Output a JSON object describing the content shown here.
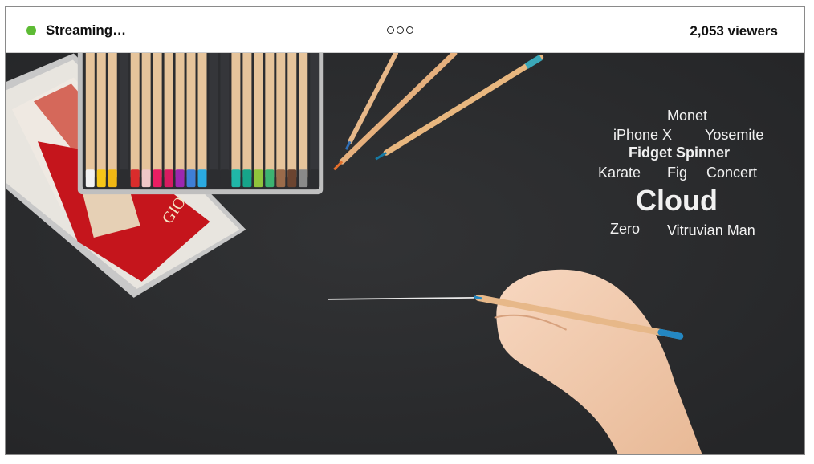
{
  "header": {
    "status_text": "Streaming…",
    "status_color": "#5dbb34",
    "viewers_text": "2,053 viewers",
    "more_icon": "more-dots-icon"
  },
  "stream": {
    "word_cloud": {
      "monet": "Monet",
      "iphone": "iPhone X",
      "yosemite": "Yosemite",
      "fidget": "Fidget Spinner",
      "karate": "Karate",
      "fig": "Fig",
      "concert": "Concert",
      "cloud": "Cloud",
      "zero": "Zero",
      "vitruvian": "Vitruvian Man"
    }
  },
  "colors": {
    "background": "#2b2c2e",
    "accent_blue": "#2fa7c7",
    "pencil_wood": "#e7b889"
  }
}
